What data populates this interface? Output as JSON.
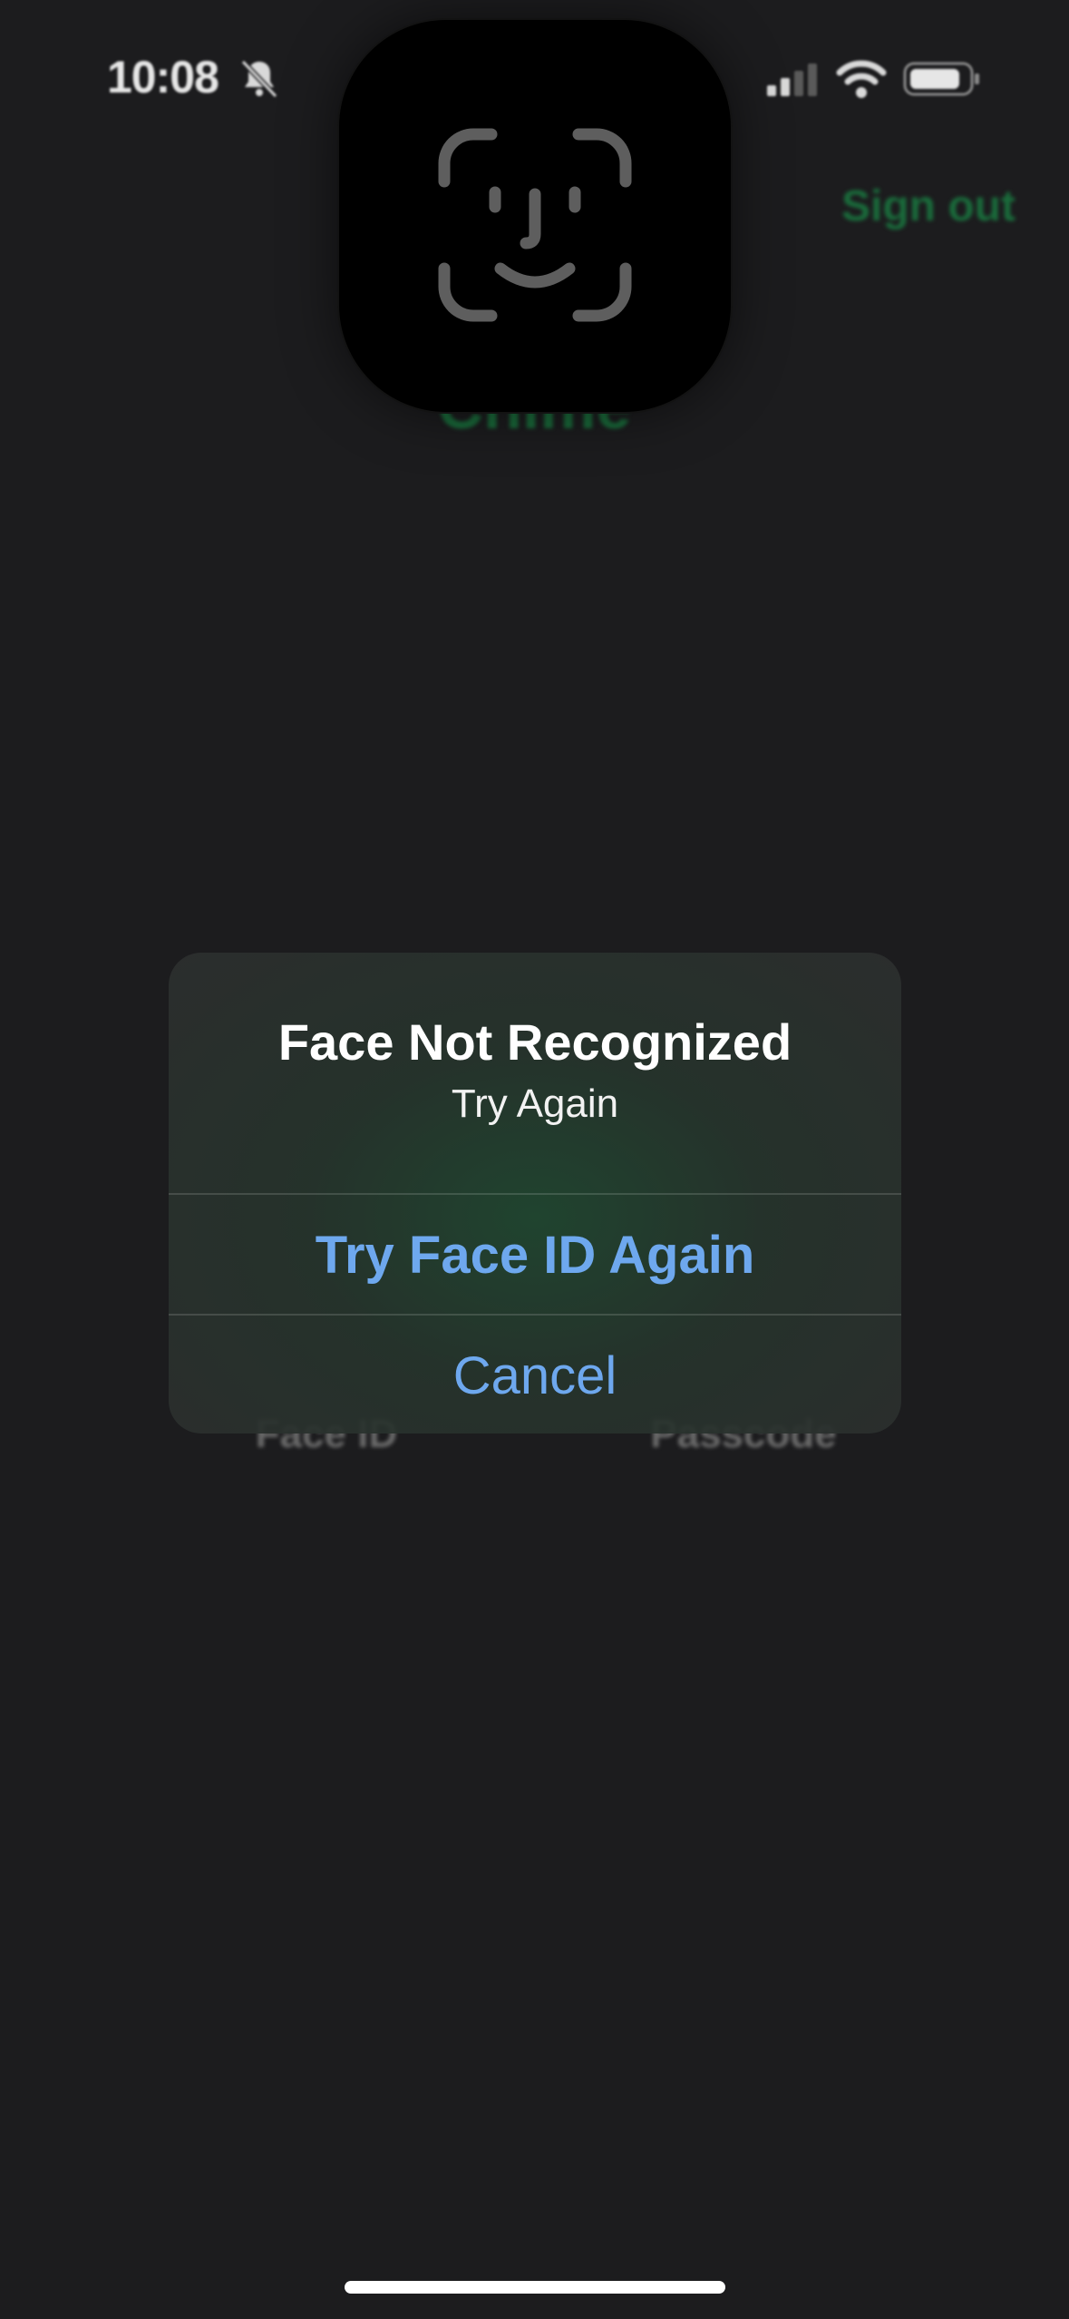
{
  "status_bar": {
    "time": "10:08",
    "icons": [
      "bell-slash-icon",
      "cellular-signal-icon",
      "wifi-icon",
      "battery-icon"
    ]
  },
  "background_app": {
    "sign_out_label": "Sign out",
    "app_name": "Chime",
    "options": {
      "face_id_label": "Face ID",
      "passcode_label": "Passcode"
    },
    "accent_color": "#1a6b3b"
  },
  "face_id_hud": {
    "icon": "face-id-icon"
  },
  "alert": {
    "title": "Face Not Recognized",
    "message": "Try Again",
    "buttons": {
      "retry_label": "Try Face ID Again",
      "cancel_label": "Cancel"
    },
    "button_color": "#6ea8ee"
  }
}
